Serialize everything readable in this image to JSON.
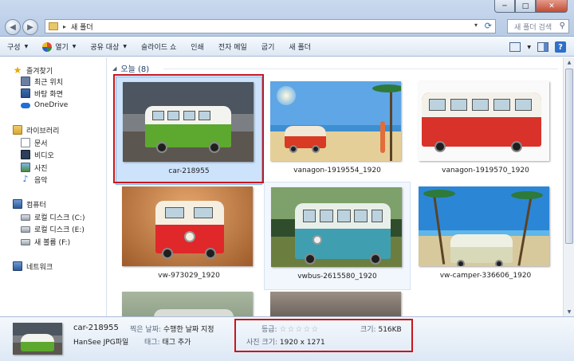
{
  "window": {
    "address_path": "새 폴더",
    "search_placeholder": "새 폴더 검색",
    "buttons": {
      "minimize": "─",
      "maximize": "□",
      "close": "✕"
    }
  },
  "toolbar": {
    "organize": "구성",
    "open": "열기",
    "share": "공유 대상",
    "slideshow": "슬라이드 쇼",
    "print": "인쇄",
    "email": "전자 메일",
    "burn": "굽기",
    "new_folder": "새 폴더"
  },
  "sidebar": {
    "favorites": {
      "label": "즐겨찾기",
      "items": [
        {
          "label": "최근 위치",
          "icon": "recent-places-icon"
        },
        {
          "label": "바탕 화면",
          "icon": "desktop-icon"
        },
        {
          "label": "OneDrive",
          "icon": "onedrive-icon"
        }
      ]
    },
    "libraries": {
      "label": "라이브러리",
      "items": [
        {
          "label": "문서",
          "icon": "documents-icon"
        },
        {
          "label": "비디오",
          "icon": "videos-icon"
        },
        {
          "label": "사진",
          "icon": "pictures-icon"
        },
        {
          "label": "음악",
          "icon": "music-icon"
        }
      ]
    },
    "computer": {
      "label": "컴퓨터",
      "items": [
        {
          "label": "로컬 디스크 (C:)",
          "icon": "disk-icon"
        },
        {
          "label": "로컬 디스크 (E:)",
          "icon": "disk-icon"
        },
        {
          "label": "새 볼륨 (F:)",
          "icon": "disk-icon"
        }
      ]
    },
    "network": {
      "label": "네트워크"
    }
  },
  "content": {
    "group_header": "오늘 (8)",
    "files": [
      {
        "name": "car-218955",
        "state": "selected"
      },
      {
        "name": "vanagon-1919554_1920",
        "state": "normal"
      },
      {
        "name": "vanagon-1919570_1920",
        "state": "normal"
      },
      {
        "name": "vw-973029_1920",
        "state": "normal"
      },
      {
        "name": "vwbus-2615580_1920",
        "state": "hover"
      },
      {
        "name": "vw-camper-336606_1920",
        "state": "normal"
      }
    ]
  },
  "details": {
    "file_name": "car-218955",
    "file_type": "HanSee JPG파일",
    "date_taken_label": "찍은 날짜:",
    "date_taken_value": "수행한 날짜 지정",
    "tags_label": "태그:",
    "tags_value": "태그 추가",
    "rating_label": "등급:",
    "rating_value": 0,
    "rating_max": 5,
    "size_label": "크기:",
    "size_value": "516KB",
    "dimensions_label": "사진 크기:",
    "dimensions_value": "1920 x 1271"
  },
  "colors": {
    "highlight_box": "#c8161d",
    "selection": "#cde3fb"
  }
}
